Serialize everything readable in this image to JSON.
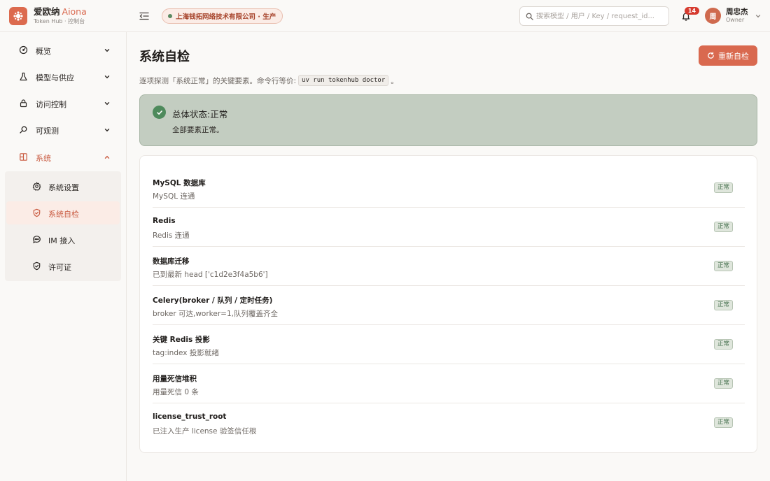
{
  "app": {
    "name_cn": "爱欧纳",
    "name_en": "Aiona",
    "subtitle": "Token Hub · 控制台",
    "accent": "#d9694f"
  },
  "header": {
    "org": "上海钱拓网络技术有限公司 · 生产",
    "search_placeholder": "搜索模型 / 用户 / Key / request_id...",
    "notifications": "14",
    "user": {
      "avatar": "周",
      "name": "周忠杰",
      "role": "Owner"
    }
  },
  "sidebar": {
    "items": [
      {
        "label": "概览",
        "icon": "gauge-icon"
      },
      {
        "label": "模型与供应",
        "icon": "flask-icon"
      },
      {
        "label": "访问控制",
        "icon": "lock-icon"
      },
      {
        "label": "可观测",
        "icon": "search-icon"
      },
      {
        "label": "系统",
        "icon": "grid-icon"
      }
    ],
    "system_children": [
      {
        "label": "系统设置",
        "icon": "gear-icon"
      },
      {
        "label": "系统自检",
        "icon": "shield-icon"
      },
      {
        "label": "IM 接入",
        "icon": "chat-icon"
      },
      {
        "label": "许可证",
        "icon": "shield-check-icon"
      }
    ]
  },
  "main": {
    "title": "系统自检",
    "recheck_label": "重新自检",
    "description_prefix": "逐项探测「系统正常」的关键要素。命令行等价:",
    "description_command": "uv run tokenhub doctor",
    "description_suffix": "。",
    "status": {
      "title": "总体状态:正常",
      "subtitle": "全部要素正常。",
      "color": "#4e8a5c"
    },
    "checks": [
      {
        "name": "MySQL 数据库",
        "detail": "MySQL 连通",
        "status": "正常"
      },
      {
        "name": "Redis",
        "detail": "Redis 连通",
        "status": "正常"
      },
      {
        "name": "数据库迁移",
        "detail": "已到最新 head ['c1d2e3f4a5b6']",
        "status": "正常"
      },
      {
        "name": "Celery(broker / 队列 / 定时任务)",
        "detail": "broker 可达,worker=1,队列覆盖齐全",
        "status": "正常"
      },
      {
        "name": "关键 Redis 投影",
        "detail": "tag:index 投影就绪",
        "status": "正常"
      },
      {
        "name": "用量死信堆积",
        "detail": "用量死信 0 条",
        "status": "正常"
      },
      {
        "name": "license_trust_root",
        "detail": "已注入生产 license 验签信任根",
        "status": "正常"
      }
    ]
  }
}
